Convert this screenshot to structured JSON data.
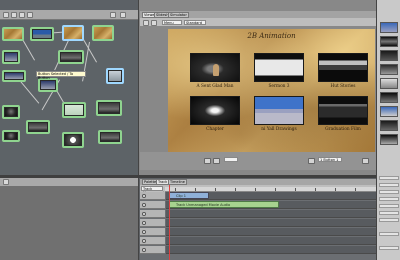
{
  "graph": {
    "tooltip": "Button Selected / To Button",
    "nodes": [
      "menu-1",
      "movie-1",
      "menu-2",
      "menu-3",
      "movie-2",
      "movie-3",
      "movie-4",
      "movie-5",
      "movie-6",
      "movie-7",
      "movie-8",
      "movie-9",
      "movie-10",
      "movie-11"
    ]
  },
  "viewer": {
    "tabs": [
      "Viewer",
      "Slideshow",
      "Simulator"
    ],
    "toolbar": {
      "view_select": "Menu",
      "zoom_select": "Standard"
    },
    "menu": {
      "title": "2B Animation",
      "buttons": [
        {
          "caption": "A Sent Glad Man"
        },
        {
          "caption": "Sermon 3"
        },
        {
          "caption": "Hut Stories"
        },
        {
          "caption": "Chapter"
        },
        {
          "caption": "ni Yall Drawings"
        },
        {
          "caption": "Graduation Film"
        }
      ]
    },
    "bottom": {
      "left_select": "",
      "right_label": "1 Button 1"
    }
  },
  "timeline": {
    "tabs": [
      "Palette",
      "Track",
      "Timeline"
    ],
    "toolbar_label": "Track Unmanaged",
    "clips": [
      {
        "label": "Clip 1"
      },
      {
        "label": "Track Unmanaged Movie Audio"
      }
    ]
  },
  "inspector": {
    "rows": [
      "",
      "",
      "",
      "",
      "",
      "",
      "",
      "",
      ""
    ]
  },
  "colors": {
    "node_border": "#8fd48f",
    "node_selected": "#9fd8ff",
    "menu_bg": "#c9a059",
    "playhead": "#e04040",
    "audio_clip": "#a7d38f"
  }
}
